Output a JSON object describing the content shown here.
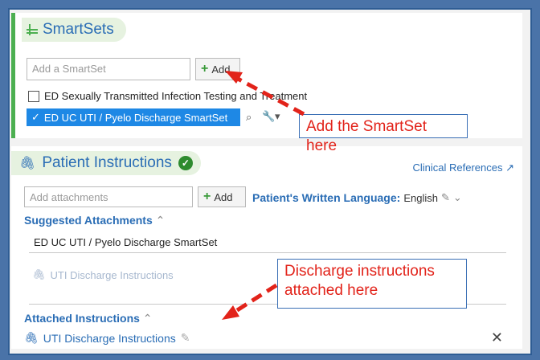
{
  "smartsets": {
    "title": "SmartSets",
    "add_placeholder": "Add a SmartSet",
    "add_label": "Add",
    "unchecked_item": "ED Sexually Transmitted Infection Testing and Treatment",
    "selected_item": "ED UC UTI / Pyelo Discharge SmartSet"
  },
  "patient_instructions": {
    "title": "Patient Instructions",
    "clinical_references": "Clinical References",
    "attach_placeholder": "Add attachments",
    "add_label": "Add",
    "written_language_label": "Patient's Written Language:",
    "written_language_value": "English",
    "suggested_header": "Suggested Attachments",
    "suggested_group": "ED UC UTI / Pyelo Discharge SmartSet",
    "suggested_item": "UTI Discharge Instructions",
    "attached_header": "Attached Instructions",
    "attached_item": "UTI Discharge Instructions"
  },
  "annotations": {
    "callout1": "Add the SmartSet here",
    "callout2_line1": "Discharge instructions",
    "callout2_line2": "attached here"
  },
  "colors": {
    "accent_blue": "#2a6db5",
    "selected_blue": "#1e88e5",
    "green": "#4caf50",
    "callout_red": "#e2231a"
  }
}
